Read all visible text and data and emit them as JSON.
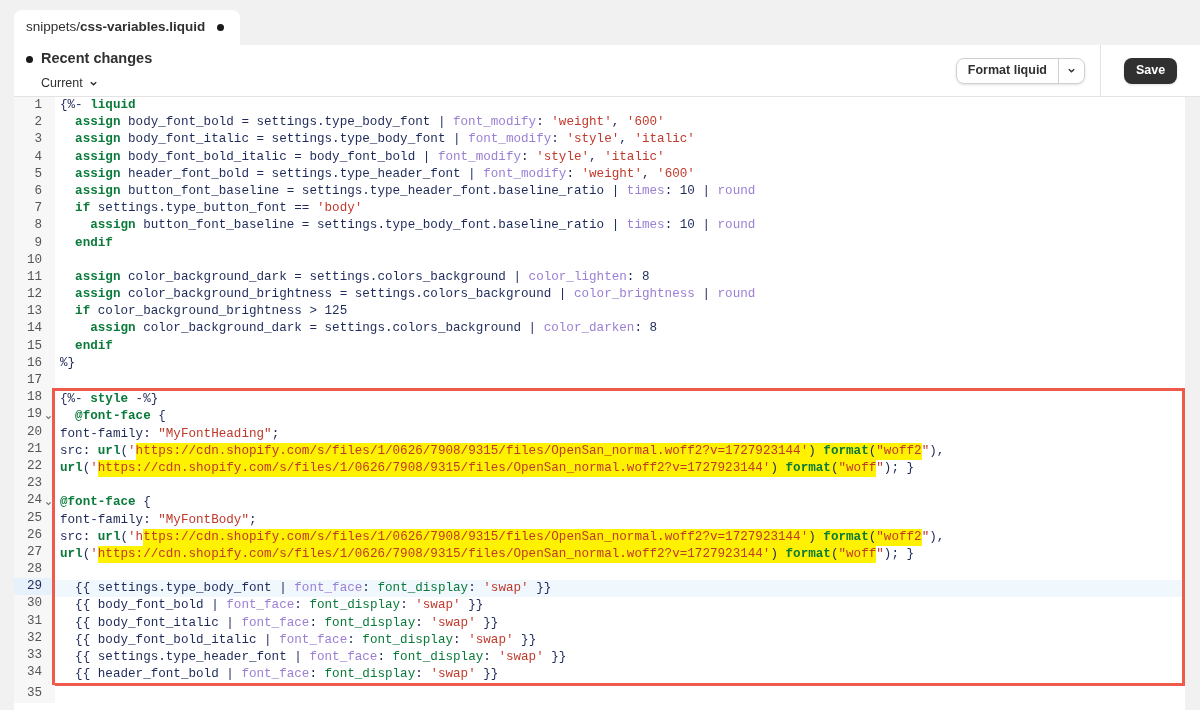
{
  "tab": {
    "title": "snippets/**css-variables.liquid**",
    "modified": true
  },
  "toolbar": {
    "history": {
      "title": "Recent changes",
      "version": "Current"
    },
    "format_button": "Format liquid",
    "save_button": "Save"
  },
  "code": {
    "sections": [
      {
        "framed": false,
        "lines": [
          {
            "number": "1",
            "active": false,
            "foldable": false,
            "tokens": [
              {
                "text": "{%- ",
                "kind": "plain"
              },
              {
                "text": "liquid",
                "kind": "keyword"
              }
            ]
          },
          {
            "number": "2",
            "active": false,
            "foldable": false,
            "tokens": [
              {
                "text": "  assign",
                "kind": "keyword"
              },
              {
                "text": " body_font_bold = settings.type_body_font | ",
                "kind": "plain"
              },
              {
                "text": "font_modify",
                "kind": "filter"
              },
              {
                "text": ": ",
                "kind": "plain"
              },
              {
                "text": "'weight'",
                "kind": "string"
              },
              {
                "text": ", ",
                "kind": "plain"
              },
              {
                "text": "'600'",
                "kind": "string"
              }
            ]
          },
          {
            "number": "3",
            "active": false,
            "foldable": false,
            "tokens": [
              {
                "text": "  assign",
                "kind": "keyword"
              },
              {
                "text": " body_font_italic = settings.type_body_font | ",
                "kind": "plain"
              },
              {
                "text": "font_modify",
                "kind": "filter"
              },
              {
                "text": ": ",
                "kind": "plain"
              },
              {
                "text": "'style'",
                "kind": "string"
              },
              {
                "text": ", ",
                "kind": "plain"
              },
              {
                "text": "'italic'",
                "kind": "string"
              }
            ]
          },
          {
            "number": "4",
            "active": false,
            "foldable": false,
            "tokens": [
              {
                "text": "  assign",
                "kind": "keyword"
              },
              {
                "text": " body_font_bold_italic = body_font_bold | ",
                "kind": "plain"
              },
              {
                "text": "font_modify",
                "kind": "filter"
              },
              {
                "text": ": ",
                "kind": "plain"
              },
              {
                "text": "'style'",
                "kind": "string"
              },
              {
                "text": ", ",
                "kind": "plain"
              },
              {
                "text": "'italic'",
                "kind": "string"
              }
            ]
          },
          {
            "number": "5",
            "active": false,
            "foldable": false,
            "tokens": [
              {
                "text": "  assign",
                "kind": "keyword"
              },
              {
                "text": " header_font_bold = settings.type_header_font | ",
                "kind": "plain"
              },
              {
                "text": "font_modify",
                "kind": "filter"
              },
              {
                "text": ": ",
                "kind": "plain"
              },
              {
                "text": "'weight'",
                "kind": "string"
              },
              {
                "text": ", ",
                "kind": "plain"
              },
              {
                "text": "'600'",
                "kind": "string"
              }
            ]
          },
          {
            "number": "6",
            "active": false,
            "foldable": false,
            "tokens": [
              {
                "text": "  assign",
                "kind": "keyword"
              },
              {
                "text": " button_font_baseline = settings.type_header_font.baseline_ratio | ",
                "kind": "plain"
              },
              {
                "text": "times",
                "kind": "filter"
              },
              {
                "text": ": 10 | ",
                "kind": "plain"
              },
              {
                "text": "round",
                "kind": "filter"
              }
            ]
          },
          {
            "number": "7",
            "active": false,
            "foldable": false,
            "tokens": [
              {
                "text": "  if",
                "kind": "keyword"
              },
              {
                "text": " settings.type_button_font == ",
                "kind": "plain"
              },
              {
                "text": "'body'",
                "kind": "string"
              }
            ]
          },
          {
            "number": "8",
            "active": false,
            "foldable": false,
            "tokens": [
              {
                "text": "    assign",
                "kind": "keyword"
              },
              {
                "text": " button_font_baseline = settings.type_body_font.baseline_ratio | ",
                "kind": "plain"
              },
              {
                "text": "times",
                "kind": "filter"
              },
              {
                "text": ": 10 | ",
                "kind": "plain"
              },
              {
                "text": "round",
                "kind": "filter"
              }
            ]
          },
          {
            "number": "9",
            "active": false,
            "foldable": false,
            "tokens": [
              {
                "text": "  endif",
                "kind": "keyword"
              }
            ]
          },
          {
            "number": "10",
            "active": false,
            "foldable": false
          },
          {
            "number": "11",
            "active": false,
            "foldable": false,
            "tokens": [
              {
                "text": "  assign",
                "kind": "keyword"
              },
              {
                "text": " color_background_dark = settings.colors_background | ",
                "kind": "plain"
              },
              {
                "text": "color_lighten",
                "kind": "filter"
              },
              {
                "text": ": 8",
                "kind": "plain"
              }
            ]
          },
          {
            "number": "12",
            "active": false,
            "foldable": false,
            "tokens": [
              {
                "text": "  assign",
                "kind": "keyword"
              },
              {
                "text": " color_background_brightness = settings.colors_background | ",
                "kind": "plain"
              },
              {
                "text": "color_brightness",
                "kind": "filter"
              },
              {
                "text": " | ",
                "kind": "plain"
              },
              {
                "text": "round",
                "kind": "filter"
              }
            ]
          },
          {
            "number": "13",
            "active": false,
            "foldable": false,
            "tokens": [
              {
                "text": "  if",
                "kind": "keyword"
              },
              {
                "text": " color_background_brightness > 125",
                "kind": "plain"
              }
            ]
          },
          {
            "number": "14",
            "active": false,
            "foldable": false,
            "tokens": [
              {
                "text": "    assign",
                "kind": "keyword"
              },
              {
                "text": " color_background_dark = settings.colors_background | ",
                "kind": "plain"
              },
              {
                "text": "color_darken",
                "kind": "filter"
              },
              {
                "text": ": 8",
                "kind": "plain"
              }
            ]
          },
          {
            "number": "15",
            "active": false,
            "foldable": false,
            "tokens": [
              {
                "text": "  endif",
                "kind": "keyword"
              }
            ]
          },
          {
            "number": "16",
            "active": false,
            "foldable": false,
            "tokens": [
              {
                "text": "%}",
                "kind": "plain"
              }
            ]
          },
          {
            "number": "17",
            "active": false,
            "foldable": false
          }
        ]
      },
      {
        "framed": true,
        "lines": [
          {
            "number": "18",
            "active": false,
            "foldable": false,
            "tokens": [
              {
                "text": "{%- ",
                "kind": "plain"
              },
              {
                "text": "style",
                "kind": "keyword"
              },
              {
                "text": " -%}",
                "kind": "plain"
              }
            ]
          },
          {
            "number": "19",
            "active": false,
            "foldable": true,
            "tokens": [
              {
                "text": "  @font-face",
                "kind": "keyword"
              },
              {
                "text": " {",
                "kind": "plain"
              }
            ]
          },
          {
            "number": "20",
            "active": false,
            "foldable": false,
            "tokens": [
              {
                "text": "font-family: ",
                "kind": "plain"
              },
              {
                "text": "\"MyFontHeading\"",
                "kind": "string"
              },
              {
                "text": ";",
                "kind": "plain"
              }
            ]
          },
          {
            "number": "21",
            "active": false,
            "foldable": false,
            "tokens": [
              {
                "text": "src: ",
                "kind": "plain"
              },
              {
                "text": "url",
                "kind": "keyword"
              },
              {
                "text": "(",
                "kind": "plain"
              },
              {
                "text": "'",
                "kind": "string"
              },
              {
                "text": "https://cdn.shopify.com/s/files/1/0626/7908/9315/files/OpenSan_normal.woff2?v=1727923144'",
                "kind": "matchstring"
              },
              {
                "text": ") ",
                "kind": "matchplain"
              },
              {
                "text": "format",
                "kind": "matchkeyword"
              },
              {
                "text": "(",
                "kind": "matchplain"
              },
              {
                "text": "\"woff2",
                "kind": "matchstring"
              },
              {
                "text": "\"",
                "kind": "string"
              },
              {
                "text": "),",
                "kind": "plain"
              }
            ]
          },
          {
            "number": "22",
            "active": false,
            "foldable": false,
            "tokens": [
              {
                "text": "url",
                "kind": "keyword"
              },
              {
                "text": "(",
                "kind": "plain"
              },
              {
                "text": "'",
                "kind": "string"
              },
              {
                "text": "https://cdn.shopify.com/s/files/1/0626/7908/9315/files/OpenSan_normal.woff2?v=1727923144'",
                "kind": "matchstring"
              },
              {
                "text": ") ",
                "kind": "matchplain"
              },
              {
                "text": "format",
                "kind": "matchkeyword"
              },
              {
                "text": "(",
                "kind": "matchplain"
              },
              {
                "text": "\"woff",
                "kind": "matchstring"
              },
              {
                "text": "\"",
                "kind": "string"
              },
              {
                "text": "); }",
                "kind": "plain"
              }
            ]
          },
          {
            "number": "23",
            "active": false,
            "foldable": false
          },
          {
            "number": "24",
            "active": false,
            "foldable": true,
            "tokens": [
              {
                "text": "@font-face",
                "kind": "keyword"
              },
              {
                "text": " {",
                "kind": "plain"
              }
            ]
          },
          {
            "number": "25",
            "active": false,
            "foldable": false,
            "tokens": [
              {
                "text": "font-family: ",
                "kind": "plain"
              },
              {
                "text": "\"MyFontBody\"",
                "kind": "string"
              },
              {
                "text": ";",
                "kind": "plain"
              }
            ]
          },
          {
            "number": "26",
            "active": false,
            "foldable": false,
            "tokens": [
              {
                "text": "src: ",
                "kind": "plain"
              },
              {
                "text": "url",
                "kind": "keyword"
              },
              {
                "text": "(",
                "kind": "plain"
              },
              {
                "text": "'h",
                "kind": "string"
              },
              {
                "text": "ttps://cdn.shopify.com/s/files/1/0626/7908/9315/files/OpenSan_normal.woff2?v=1727923144'",
                "kind": "matchstring"
              },
              {
                "text": ") ",
                "kind": "matchplain"
              },
              {
                "text": "format",
                "kind": "matchkeyword"
              },
              {
                "text": "(",
                "kind": "matchplain"
              },
              {
                "text": "\"woff2",
                "kind": "matchstring"
              },
              {
                "text": "\"",
                "kind": "string"
              },
              {
                "text": "),",
                "kind": "plain"
              }
            ]
          },
          {
            "number": "27",
            "active": false,
            "foldable": false,
            "tokens": [
              {
                "text": "url",
                "kind": "keyword"
              },
              {
                "text": "(",
                "kind": "plain"
              },
              {
                "text": "'",
                "kind": "string"
              },
              {
                "text": "https://cdn.shopify.com/s/files/1/0626/7908/9315/files/OpenSan_normal.woff2?v=1727923144'",
                "kind": "matchstring"
              },
              {
                "text": ") ",
                "kind": "matchplain"
              },
              {
                "text": "format",
                "kind": "matchkeyword"
              },
              {
                "text": "(",
                "kind": "matchplain"
              },
              {
                "text": "\"woff",
                "kind": "matchstring"
              },
              {
                "text": "\"",
                "kind": "string"
              },
              {
                "text": "); }",
                "kind": "plain"
              }
            ]
          },
          {
            "number": "28",
            "active": false,
            "foldable": false
          },
          {
            "number": "29",
            "active": true,
            "foldable": false,
            "tokens": [
              {
                "text": "  {{ settings.type_body_font | ",
                "kind": "plain"
              },
              {
                "text": "font_face",
                "kind": "filter"
              },
              {
                "text": ": ",
                "kind": "plain"
              },
              {
                "text": "font_display",
                "kind": "attribute"
              },
              {
                "text": ": ",
                "kind": "plain"
              },
              {
                "text": "'swap'",
                "kind": "string"
              },
              {
                "text": " }}",
                "kind": "plain"
              }
            ]
          },
          {
            "number": "30",
            "active": false,
            "foldable": false,
            "tokens": [
              {
                "text": "  {{ body_font_bold | ",
                "kind": "plain"
              },
              {
                "text": "font_face",
                "kind": "filter"
              },
              {
                "text": ": ",
                "kind": "plain"
              },
              {
                "text": "font_display",
                "kind": "attribute"
              },
              {
                "text": ": ",
                "kind": "plain"
              },
              {
                "text": "'swap'",
                "kind": "string"
              },
              {
                "text": " }}",
                "kind": "plain"
              }
            ]
          },
          {
            "number": "31",
            "active": false,
            "foldable": false,
            "tokens": [
              {
                "text": "  {{ body_font_italic | ",
                "kind": "plain"
              },
              {
                "text": "font_face",
                "kind": "filter"
              },
              {
                "text": ": ",
                "kind": "plain"
              },
              {
                "text": "font_display",
                "kind": "attribute"
              },
              {
                "text": ": ",
                "kind": "plain"
              },
              {
                "text": "'swap'",
                "kind": "string"
              },
              {
                "text": " }}",
                "kind": "plain"
              }
            ]
          },
          {
            "number": "32",
            "active": false,
            "foldable": false,
            "tokens": [
              {
                "text": "  {{ body_font_bold_italic | ",
                "kind": "plain"
              },
              {
                "text": "font_face",
                "kind": "filter"
              },
              {
                "text": ": ",
                "kind": "plain"
              },
              {
                "text": "font_display",
                "kind": "attribute"
              },
              {
                "text": ": ",
                "kind": "plain"
              },
              {
                "text": "'swap'",
                "kind": "string"
              },
              {
                "text": " }}",
                "kind": "plain"
              }
            ]
          },
          {
            "number": "33",
            "active": false,
            "foldable": false,
            "tokens": [
              {
                "text": "  {{ settings.type_header_font | ",
                "kind": "plain"
              },
              {
                "text": "font_face",
                "kind": "filter"
              },
              {
                "text": ": ",
                "kind": "plain"
              },
              {
                "text": "font_display",
                "kind": "attribute"
              },
              {
                "text": ": ",
                "kind": "plain"
              },
              {
                "text": "'swap'",
                "kind": "string"
              },
              {
                "text": " }}",
                "kind": "plain"
              }
            ]
          },
          {
            "number": "34",
            "active": false,
            "foldable": false,
            "tokens": [
              {
                "text": "  {{ header_font_bold | ",
                "kind": "plain"
              },
              {
                "text": "font_face",
                "kind": "filter"
              },
              {
                "text": ": ",
                "kind": "plain"
              },
              {
                "text": "font_display",
                "kind": "attribute"
              },
              {
                "text": ": ",
                "kind": "plain"
              },
              {
                "text": "'swap'",
                "kind": "string"
              },
              {
                "text": " }}",
                "kind": "plain"
              }
            ]
          }
        ]
      },
      {
        "framed": false,
        "lines": [
          {
            "number": "35",
            "active": false,
            "foldable": false
          }
        ]
      }
    ]
  }
}
